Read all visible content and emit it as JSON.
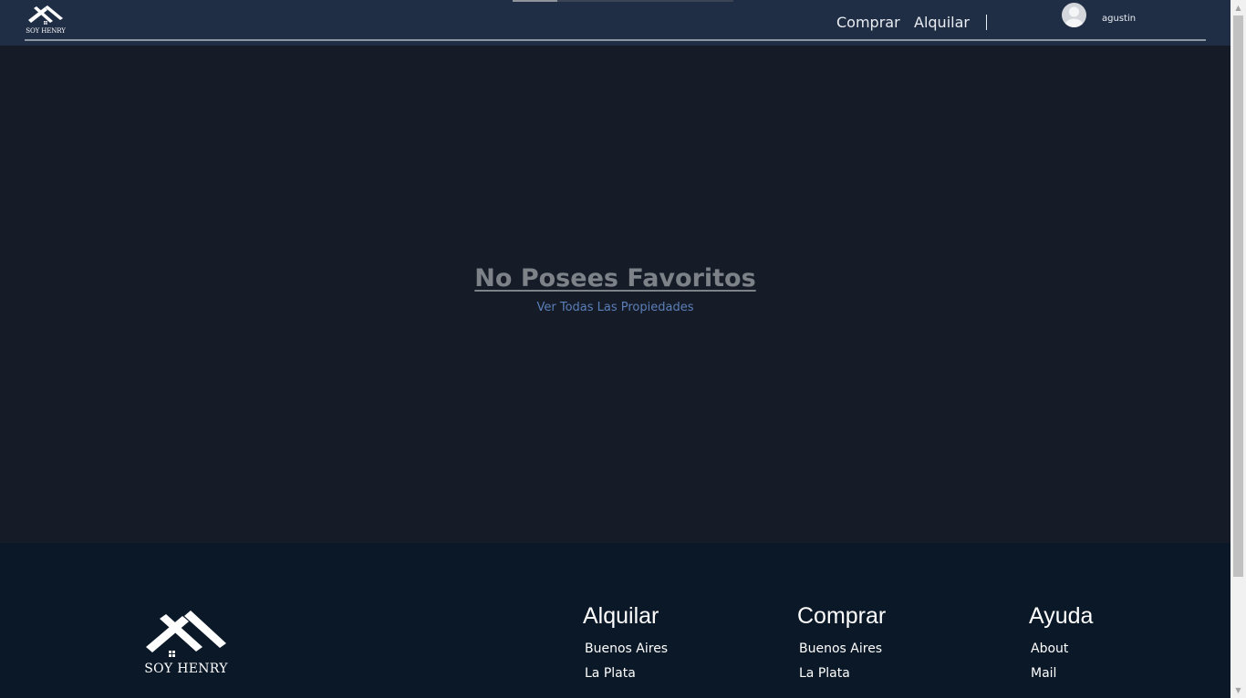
{
  "brand": {
    "logo_text": "SOY HENRY"
  },
  "header": {
    "nav": {
      "comprar": "Comprar",
      "alquilar": "Alquilar"
    },
    "user": {
      "username": "agustin"
    }
  },
  "main": {
    "empty_title": "No Posees Favoritos",
    "empty_link": "Ver Todas Las Propiedades"
  },
  "footer": {
    "logo_text": "SOY HENRY",
    "columns": [
      {
        "title": "Alquilar",
        "links": [
          "Buenos Aires",
          "La Plata"
        ]
      },
      {
        "title": "Comprar",
        "links": [
          "Buenos Aires",
          "La Plata"
        ]
      },
      {
        "title": "Ayuda",
        "links": [
          "About",
          "Mail"
        ]
      }
    ]
  },
  "colors": {
    "header_bg": "#202e45",
    "main_bg": "#151b27",
    "footer_bg": "#0b1828",
    "link_accent": "#5b7fb8"
  }
}
